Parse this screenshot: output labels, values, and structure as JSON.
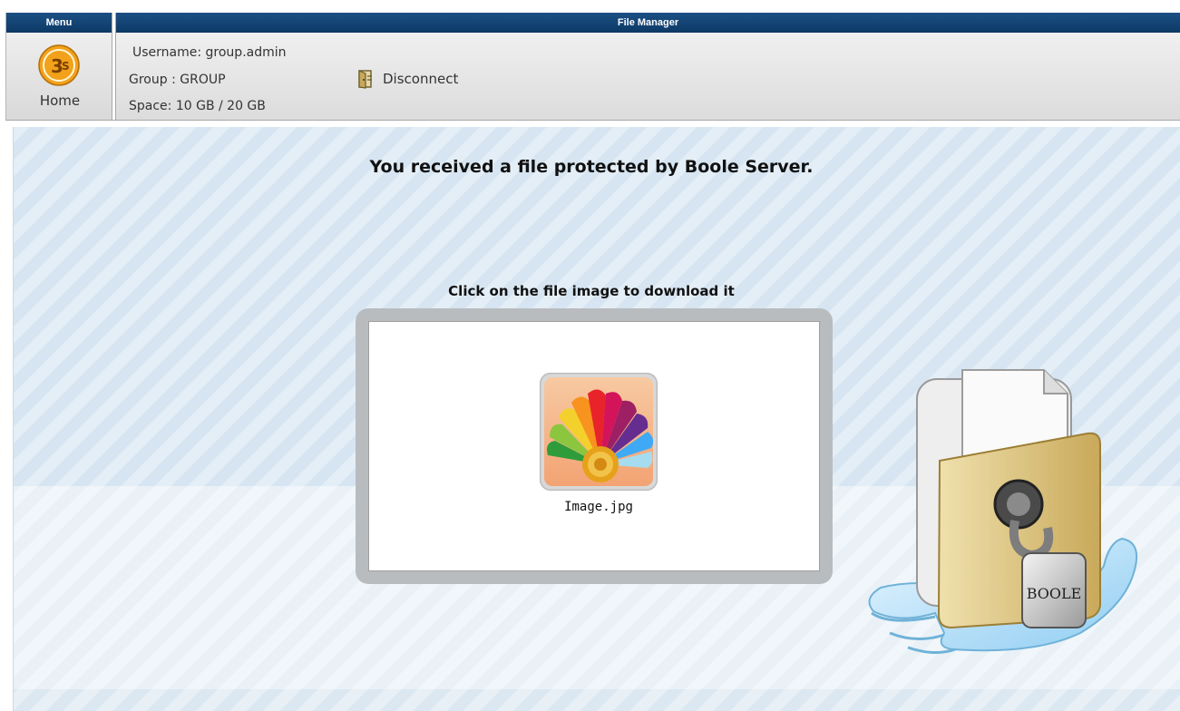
{
  "menu": {
    "header": "Menu",
    "home_label": "Home"
  },
  "file_manager": {
    "header": "File Manager",
    "username": "Username: group.admin",
    "group": "Group : GROUP",
    "space": "Space: 10 GB / 20 GB",
    "disconnect_label": "Disconnect"
  },
  "main": {
    "title": "You received a file protected by Boole Server.",
    "instruction": "Click on the file image to download it",
    "file": {
      "name": "Image.jpg",
      "icon": "flower-image-icon"
    }
  },
  "illustration": {
    "lock_text": "BOOLE",
    "icon": "locked-folder-hand-icon"
  },
  "colors": {
    "header_bg": "#0d3a66",
    "main_bg": "#d6e5f1",
    "frame": "#b9bcbf"
  }
}
